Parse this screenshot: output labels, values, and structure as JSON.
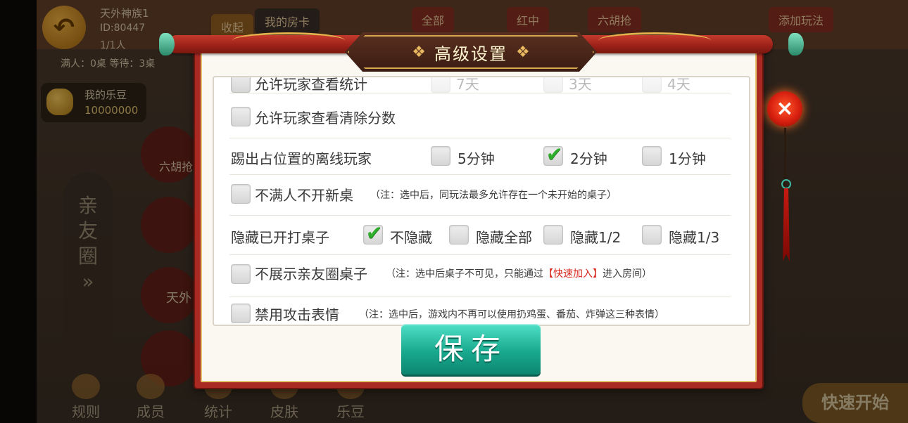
{
  "background": {
    "room_name": "天外神族1",
    "room_id": "ID:80447",
    "player_count": "1/1人",
    "status_line": "满人：0桌   等待：3桌",
    "collapse_label": "收起",
    "my_card_label": "我的房卡",
    "my_beans_label": "我的乐豆",
    "my_beans_value": "10000000",
    "top_tabs": [
      "全部",
      "红中",
      "六胡抢",
      "添加玩法"
    ],
    "friend_circle_label": "亲友圈",
    "table_labels": [
      "六胡抢",
      "天外"
    ],
    "bottom_nav": [
      "规则",
      "成员",
      "统计",
      "皮肤",
      "乐豆"
    ],
    "quick_start_label": "快速开始"
  },
  "dialog": {
    "title": "高级设置",
    "rows": {
      "allow_stats": {
        "label": "允许玩家查看统计",
        "faded_options": [
          "7天",
          "3天",
          "4天"
        ]
      },
      "allow_clear": {
        "label": "允许玩家查看清除分数"
      },
      "kick_offline": {
        "label": "踢出占位置的离线玩家",
        "options": [
          "5分钟",
          "2分钟",
          "1分钟"
        ],
        "selected": "2分钟"
      },
      "no_new_table": {
        "label": "不满人不开新桌",
        "note": "（注：选中后，同玩法最多允许存在一个未开始的桌子）"
      },
      "hide_tables": {
        "label": "隐藏已开打桌子",
        "options": [
          "不隐藏",
          "隐藏全部",
          "隐藏1/2",
          "隐藏1/3"
        ],
        "selected": "不隐藏"
      },
      "hide_club": {
        "label": "不展示亲友圈桌子",
        "note_prefix": "（注：选中后桌子不可见，只能通过",
        "note_highlight": "【快速加入】",
        "note_suffix": "进入房间）"
      },
      "disable_attack": {
        "label": "禁用攻击表情",
        "note": "（注：选中后，游戏内不再可以使用扔鸡蛋、番茄、炸弹这三种表情）"
      }
    },
    "save_label": "保存",
    "close_icon": "×"
  },
  "colors": {
    "dialog_red": "#a82a22",
    "check_green": "#2eae2a",
    "save_teal": "#19a98e",
    "note_red": "#d8261c"
  }
}
